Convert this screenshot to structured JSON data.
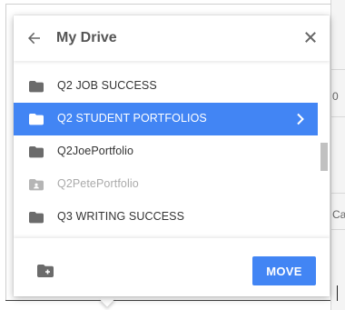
{
  "colors": {
    "accent": "#4285f4",
    "folder": "#6b6b6b",
    "folder_disabled": "#b5b5b5",
    "text": "#333333",
    "text_disabled": "#aaaaaa"
  },
  "background": {
    "fragments": [
      "0",
      "Ca"
    ]
  },
  "header": {
    "title": "My Drive",
    "back_icon": "arrow-left-icon",
    "close_icon": "close-icon"
  },
  "folders": [
    {
      "label": "Q2 JOB SUCCESS",
      "state": "normal"
    },
    {
      "label": "Q2 STUDENT PORTFOLIOS",
      "state": "selected"
    },
    {
      "label": "Q2JoePortfolio",
      "state": "normal"
    },
    {
      "label": "Q2PetePortfolio",
      "state": "disabled"
    },
    {
      "label": "Q3 WRITING SUCCESS",
      "state": "normal"
    }
  ],
  "footer": {
    "new_folder_icon": "new-folder-icon",
    "move_label": "MOVE"
  }
}
